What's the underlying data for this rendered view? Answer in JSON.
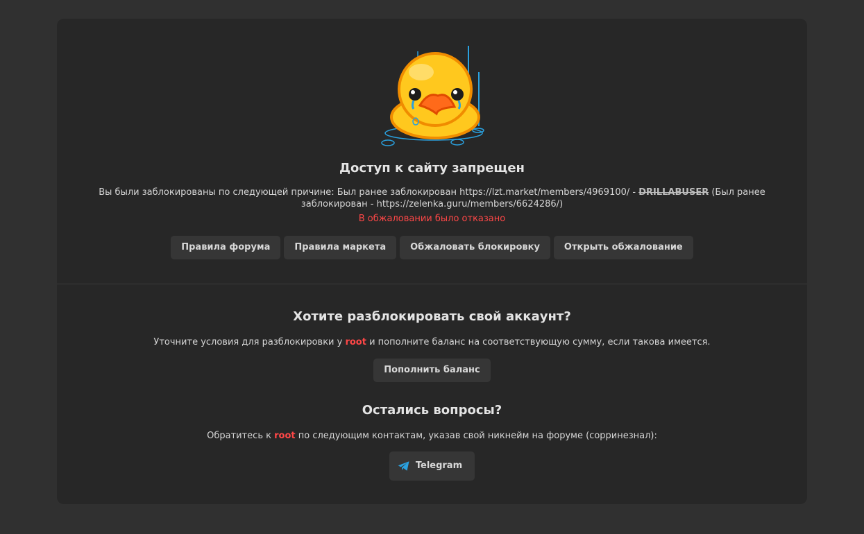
{
  "page": {
    "title": "Доступ к сайту запрещен",
    "reason_prefix": "Вы были заблокированы по следующей причине: Был ранее заблокирован https://lzt.market/members/4969100/ - ",
    "reason_struck": "DRILLABUSER",
    "reason_suffix": " (Был ранее заблокирован - https://zelenka.guru/members/6624286/)",
    "appeal_status": "В обжаловании было отказано",
    "buttons": [
      "Правила форума",
      "Правила маркета",
      "Обжаловать блокировку",
      "Открыть обжалование"
    ]
  },
  "unlock": {
    "title": "Хотите разблокировать свой аккаунт?",
    "text_before": "Уточните условия для разблокировки у ",
    "root": "root",
    "text_after": " и пополните баланс на соответствующую сумму, если такова имеется.",
    "button": "Пополнить баланс"
  },
  "questions": {
    "title": "Остались вопросы?",
    "text_before": "Обратитесь к ",
    "root": "root",
    "text_after": " по следующим контактам, указав свой никнейм на форуме (сорринезнал):",
    "telegram_label": "Telegram",
    "telegram_icon": "telegram-icon"
  },
  "colors": {
    "accent_red": "#ff4747",
    "telegram_blue": "#2aa1df",
    "duck_yellow": "#ffc81e"
  }
}
